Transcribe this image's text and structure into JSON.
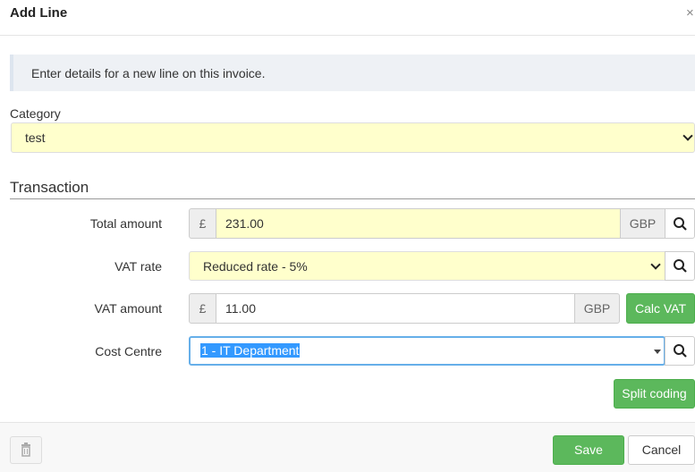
{
  "modal": {
    "title": "Add Line",
    "close_label": "×"
  },
  "info_text": "Enter details for a new line on this invoice.",
  "category": {
    "label": "Category",
    "value": "test"
  },
  "transaction": {
    "section_title": "Transaction",
    "total_amount": {
      "label": "Total amount",
      "currency_symbol": "£",
      "value": "231.00",
      "currency_code": "GBP"
    },
    "vat_rate": {
      "label": "VAT rate",
      "value": "Reduced rate - 5%"
    },
    "vat_amount": {
      "label": "VAT amount",
      "currency_symbol": "£",
      "value": "11.00",
      "currency_code": "GBP",
      "calc_button": "Calc VAT"
    },
    "cost_centre": {
      "label": "Cost Centre",
      "value": "1 - IT Department"
    },
    "split_coding_button": "Split coding"
  },
  "footer": {
    "save_button": "Save",
    "cancel_button": "Cancel"
  },
  "colors": {
    "accent_green": "#5cb85c",
    "field_highlight": "#ffffcc",
    "focus_border": "#66afe9",
    "selection": "#3399ff"
  },
  "icons": [
    "close-icon",
    "chevron-down-icon",
    "search-icon",
    "trash-icon"
  ]
}
